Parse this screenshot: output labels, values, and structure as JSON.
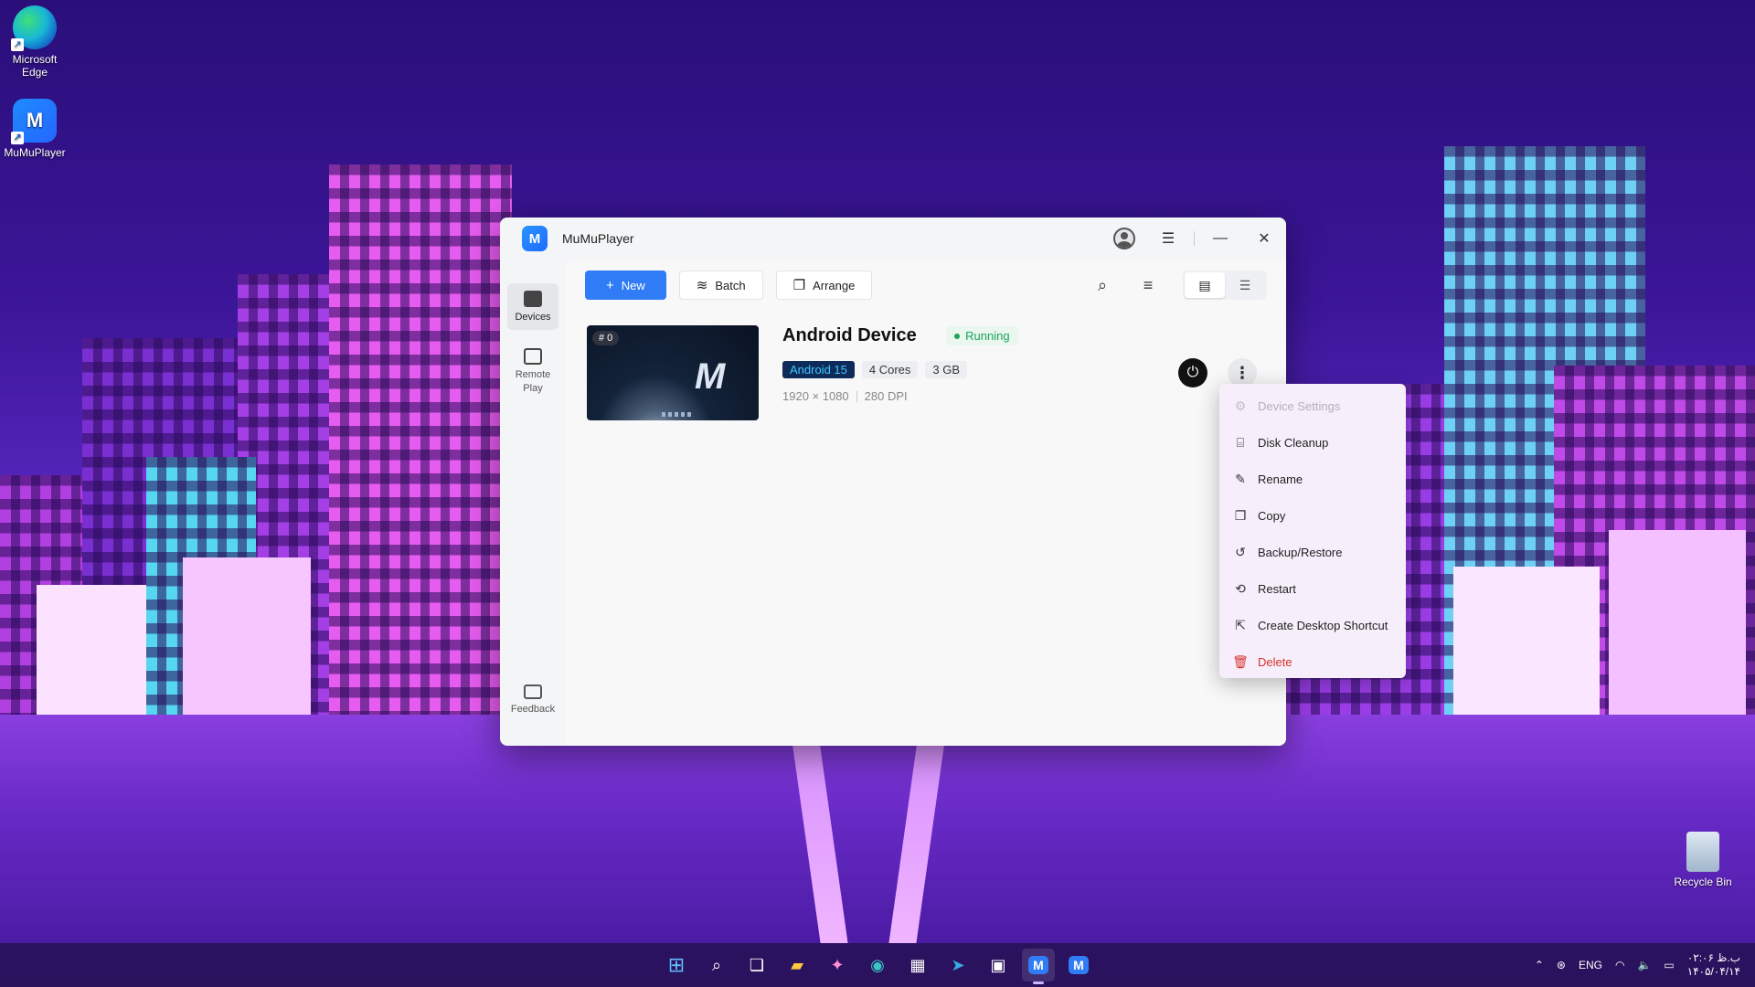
{
  "desktop": {
    "icons": [
      {
        "label": "Microsoft Edge"
      },
      {
        "label": "MuMuPlayer"
      },
      {
        "label": "Recycle Bin"
      }
    ]
  },
  "window": {
    "title": "MuMuPlayer",
    "sidebar": {
      "devices_label": "Devices",
      "remote_play_label": "Remote Play",
      "feedback_label": "Feedback"
    },
    "toolbar": {
      "new_label": "New",
      "batch_label": "Batch",
      "arrange_label": "Arrange"
    },
    "device": {
      "index_badge": "# 0",
      "name": "Android Device",
      "status": "Running",
      "android_tag": "Android 15",
      "cores_tag": "4 Cores",
      "memory_tag": "3 GB",
      "resolution": "1920 × 1080",
      "dpi": "280 DPI"
    }
  },
  "context_menu": {
    "items": [
      {
        "label": "Device Settings",
        "icon": "settings-icon",
        "state": "disabled"
      },
      {
        "label": "Disk Cleanup",
        "icon": "broom-icon"
      },
      {
        "label": "Rename",
        "icon": "pencil-icon"
      },
      {
        "label": "Copy",
        "icon": "copy-icon"
      },
      {
        "label": "Backup/Restore",
        "icon": "history-icon"
      },
      {
        "label": "Restart",
        "icon": "restart-icon"
      },
      {
        "label": "Create Desktop Shortcut",
        "icon": "shortcut-icon"
      },
      {
        "label": "Delete",
        "icon": "trash-icon",
        "state": "danger"
      }
    ]
  },
  "taskbar": {
    "language": "ENG",
    "time": "ب.ظ ۰۲:۰۶",
    "date": "۱۴۰۵/۰۴/۱۴"
  },
  "colors": {
    "primary": "#2f7cf6",
    "running": "#1aa35a",
    "danger": "#d8322d"
  }
}
